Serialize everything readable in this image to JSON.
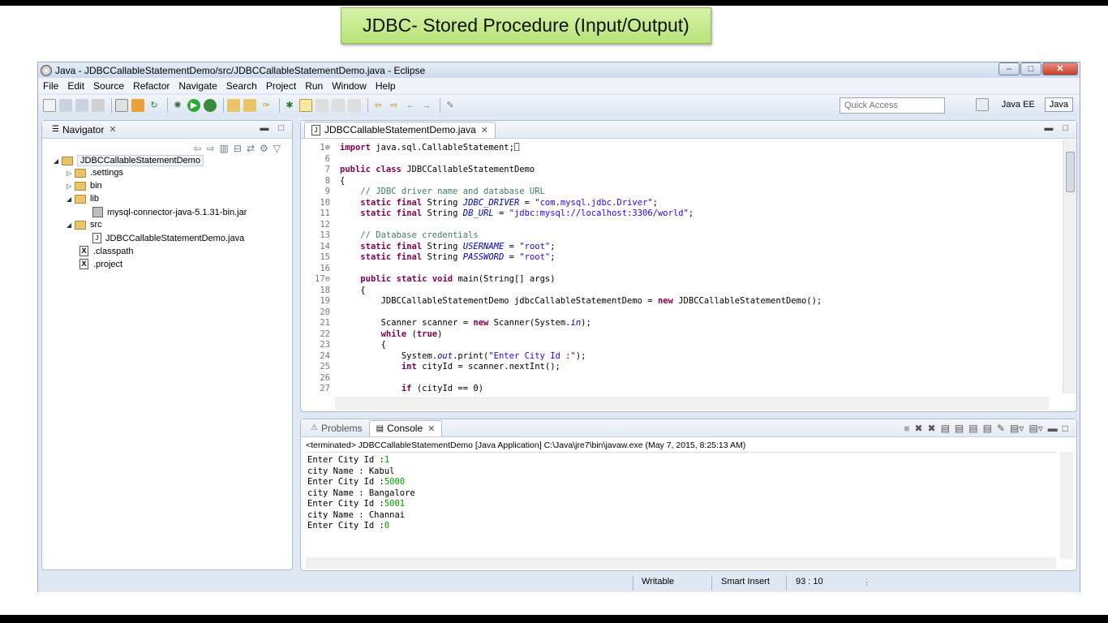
{
  "slide_title": "JDBC- Stored Procedure (Input/Output)",
  "window": {
    "title": "Java - JDBCCallableStatementDemo/src/JDBCCallableStatementDemo.java - Eclipse",
    "minimize": "–",
    "maximize": "□",
    "close": "✕"
  },
  "menu": [
    "File",
    "Edit",
    "Source",
    "Refactor",
    "Navigate",
    "Search",
    "Project",
    "Run",
    "Window",
    "Help"
  ],
  "toolbar": {
    "icons": [
      "new-icon",
      "save-icon",
      "save-all-icon",
      "print-icon",
      "build-icon",
      "new-java-icon",
      "refresh-icon",
      "debug-icon",
      "run-icon",
      "external-tools-icon",
      "open-type-icon",
      "open-task-icon",
      "search-icon",
      "annotation-icon",
      "highlight-icon",
      "toggle-icon",
      "prev-annotation-icon",
      "next-annotation-icon",
      "back-icon",
      "forward-icon",
      "pin-icon"
    ],
    "quick_access_placeholder": "Quick Access",
    "perspectives": [
      "Java EE",
      "Java"
    ]
  },
  "navigator": {
    "tab_label": "Navigator",
    "tree": [
      {
        "label": "JDBCCallableStatementDemo",
        "type": "project",
        "expanded": true
      },
      {
        "label": ".settings",
        "type": "folder"
      },
      {
        "label": "bin",
        "type": "folder"
      },
      {
        "label": "lib",
        "type": "folder",
        "expanded": true
      },
      {
        "label": "mysql-connector-java-5.1.31-bin.jar",
        "type": "jar"
      },
      {
        "label": "src",
        "type": "folder",
        "expanded": true
      },
      {
        "label": "JDBCCallableStatementDemo.java",
        "type": "java"
      },
      {
        "label": ".classpath",
        "type": "xml"
      },
      {
        "label": ".project",
        "type": "xml"
      }
    ]
  },
  "editor": {
    "tab_label": "JDBCCallableStatementDemo.java",
    "lines": [
      {
        "n": "1⊕",
        "t": "import java.sql.CallableStatement;⎕"
      },
      {
        "n": "6",
        "t": ""
      },
      {
        "n": "7",
        "t": "public class JDBCCallableStatementDemo"
      },
      {
        "n": "8",
        "t": "{"
      },
      {
        "n": "9",
        "t": "    // JDBC driver name and database URL"
      },
      {
        "n": "10",
        "t": "    static final String JDBC_DRIVER = \"com.mysql.jdbc.Driver\";"
      },
      {
        "n": "11",
        "t": "    static final String DB_URL = \"jdbc:mysql://localhost:3306/world\";"
      },
      {
        "n": "12",
        "t": ""
      },
      {
        "n": "13",
        "t": "    // Database credentials"
      },
      {
        "n": "14",
        "t": "    static final String USERNAME = \"root\";"
      },
      {
        "n": "15",
        "t": "    static final String PASSWORD = \"root\";"
      },
      {
        "n": "16",
        "t": ""
      },
      {
        "n": "17⊖",
        "t": "    public static void main(String[] args)"
      },
      {
        "n": "18",
        "t": "    {"
      },
      {
        "n": "19",
        "t": "        JDBCCallableStatementDemo jdbcCallableStatementDemo = new JDBCCallableStatementDemo();"
      },
      {
        "n": "20",
        "t": ""
      },
      {
        "n": "21",
        "t": "        Scanner scanner = new Scanner(System.in);"
      },
      {
        "n": "22",
        "t": "        while (true)"
      },
      {
        "n": "23",
        "t": "        {"
      },
      {
        "n": "24",
        "t": "            System.out.print(\"Enter City Id :\");"
      },
      {
        "n": "25",
        "t": "            int cityId = scanner.nextInt();"
      },
      {
        "n": "26",
        "t": ""
      },
      {
        "n": "27",
        "t": "            if (cityId == 0)"
      }
    ]
  },
  "console": {
    "tab_problems": "Problems",
    "tab_console": "Console",
    "terminated": "<terminated> JDBCCallableStatementDemo [Java Application] C:\\Java\\jre7\\bin\\javaw.exe (May 7, 2015, 8:25:13 AM)",
    "output": [
      {
        "text": "Enter City Id :",
        "input": "1"
      },
      {
        "text": "city Name : Kabul",
        "input": ""
      },
      {
        "text": "Enter City Id :",
        "input": "5000"
      },
      {
        "text": "city Name : Bangalore",
        "input": ""
      },
      {
        "text": "Enter City Id :",
        "input": "5001"
      },
      {
        "text": "city Name : Channai",
        "input": ""
      },
      {
        "text": "Enter City Id :",
        "input": "0"
      }
    ]
  },
  "status": {
    "writable": "Writable",
    "insert_mode": "Smart Insert",
    "position": "93 : 10"
  },
  "colors": {
    "keyword": "#7f0055",
    "comment": "#3f7f5f",
    "string": "#2a00ff",
    "static_field": "#0000c0",
    "console_input": "#00a000",
    "slide_title_bg": "#c7ea8f"
  }
}
